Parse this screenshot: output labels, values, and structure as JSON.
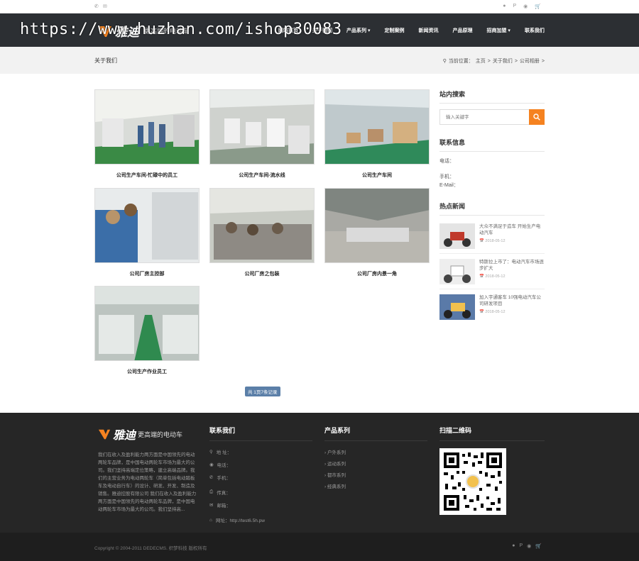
{
  "topbar": {
    "phone_icon": "phone-icon",
    "mail_icon": "mail-icon",
    "right_icons": [
      "weibo-icon",
      "pinterest-icon",
      "qq-icon",
      "cart-icon"
    ]
  },
  "nav": {
    "logo_text": "雅迪",
    "logo_sub": "更高端的电动车",
    "menu": [
      "网站首页",
      "关于我们",
      "产品系列 ▾",
      "定制案例",
      "新闻资讯",
      "产品原理",
      "招商加盟 ▾",
      "联系我们"
    ]
  },
  "watermark": "https://www.huzhan.com/ishop30083",
  "page_title": "关于我们",
  "breadcrumb": {
    "prefix": "当前位置：",
    "home": "主页",
    "sep": ">",
    "about": "关于我们",
    "current": "公司相册",
    "tail": ">"
  },
  "gallery": [
    {
      "caption": "公司生产车间-忙碌中的员工"
    },
    {
      "caption": "公司生产车间-流水线"
    },
    {
      "caption": "公司生产车间"
    },
    {
      "caption": "公司厂房主控部"
    },
    {
      "caption": "公司厂房之包装"
    },
    {
      "caption": "公司厂房内景一角"
    },
    {
      "caption": "公司生产作业员工"
    }
  ],
  "pager": "共 1页7条记录",
  "sidebar": {
    "search_title": "站内搜索",
    "search_placeholder": "输入关键字",
    "contact_title": "联系信息",
    "phone_label": "电话：",
    "mobile_label": "手机：",
    "email_label": "E-Mail：",
    "news_title": "热点新闻",
    "news": [
      {
        "title": "大众不满足于造车 开始生产电动汽车",
        "date": "2018-05-12"
      },
      {
        "title": "特斯拉上市了：电动汽车市场逐步扩大",
        "date": "2018-05-12"
      },
      {
        "title": "加入宇通客车 10强电动汽车公司研发项目",
        "date": "2018-05-12"
      }
    ]
  },
  "footer": {
    "about_text": "我们在收入及盈利能力两方面是中国领先的电动两轮车品牌，是中国电动两轮车市场为最大的公司。我们坚持高端定位策略，建立高端品牌。我们的主营业务为电动两轮车（简单包括电动踏板车及电动自行车）的设计、研发、开发、制造及销售。雅迪控股有限公司 我们在收入及盈利能力两方面是中国领先的电动两轮车品牌，是中国电动两轮车市场为最大的公司。我们坚持高...",
    "contact_title": "联系我们",
    "address": "地 址：",
    "phone": "电话：",
    "mobile": "手机：",
    "fax": "传真：",
    "email": "邮箱：",
    "website": "网址：http://test6.5h.pw",
    "products_title": "产品系列",
    "products": [
      "户外系列",
      "运动系列",
      "都市系列",
      "经典系列"
    ],
    "qr_title": "扫描二维码"
  },
  "copyright": "Copyright © 2004-2011 DEDECMS. 织梦科技 版权所有",
  "colors": {
    "nav_bg": "#2c2f33",
    "accent": "#f58220",
    "footer_bg": "#262626"
  }
}
